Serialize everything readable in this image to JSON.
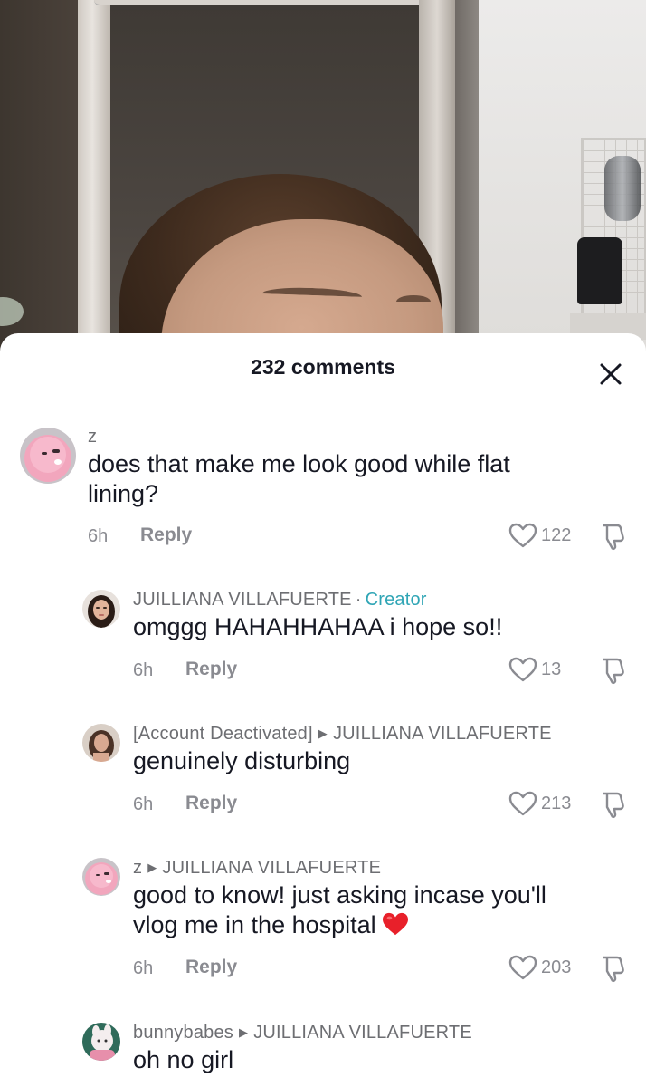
{
  "sheet": {
    "comment_count_label": "232 comments"
  },
  "comments": [
    {
      "username": "z",
      "text_line1": "does that make me look good while flat",
      "text_line2": "lining?",
      "time": "6h",
      "reply_label": "Reply",
      "likes": "122"
    },
    {
      "username": "JUILLIANA VILLAFUERTE",
      "badge_separator": "·",
      "badge": "Creator",
      "text": "omggg HAHAHHAHAA i hope so!!",
      "time": "6h",
      "reply_label": "Reply",
      "likes": "13"
    },
    {
      "username": "[Account Deactivated]",
      "reply_to": "JUILLIANA VILLAFUERTE",
      "text": "genuinely disturbing",
      "time": "6h",
      "reply_label": "Reply",
      "likes": "213"
    },
    {
      "username": "z",
      "reply_to": "JUILLIANA VILLAFUERTE",
      "text_line1": "good to know! just asking incase you'll",
      "text_line2": "vlog me in the hospital",
      "emoji": "red-heart",
      "time": "6h",
      "reply_label": "Reply",
      "likes": "203"
    },
    {
      "username": "bunnybabes",
      "reply_to": "JUILLIANA VILLAFUERTE",
      "text": "oh no girl"
    }
  ],
  "colors": {
    "creator_badge": "#2fa5b5",
    "muted_text": "#8a8b91",
    "primary_text": "#161823",
    "heart_emoji": "#e8202a"
  }
}
